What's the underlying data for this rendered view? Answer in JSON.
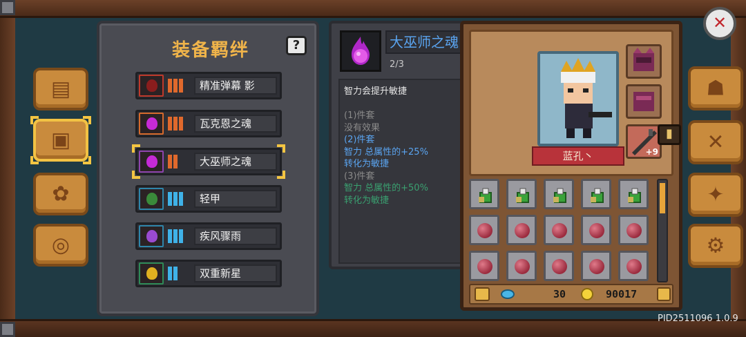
{
  "panel": {
    "title": "装备羁绊",
    "help_label": "?"
  },
  "sets": [
    {
      "name": "精准弹幕 影",
      "rarity": "orange",
      "tiers": 3,
      "icon": "fire-orb-icon",
      "icon_color": "#c0392b"
    },
    {
      "name": "瓦克恩之魂",
      "rarity": "orange",
      "tiers": 3,
      "icon": "purple-soul-flame-icon",
      "icon_color": "#d66a2c"
    },
    {
      "name": "大巫师之魂",
      "rarity": "orange",
      "tiers": 2,
      "icon": "purple-soul-flame-icon",
      "icon_color": "#8e44ad",
      "selected": true
    },
    {
      "name": "轻甲",
      "rarity": "blue",
      "tiers": 3,
      "icon": "leather-armor-icon",
      "icon_color": "#2e86ab"
    },
    {
      "name": "疾风骤雨",
      "rarity": "blue",
      "tiers": 3,
      "icon": "whirlwind-icon",
      "icon_color": "#2e86ab"
    },
    {
      "name": "双重新星",
      "rarity": "blue",
      "tiers": 2,
      "icon": "target-ring-icon",
      "icon_color": "#2e8b57"
    }
  ],
  "tooltip": {
    "name": "大巫师之魂",
    "count": "2/3",
    "description": "智力会提升敏捷",
    "lines": [
      {
        "text": "",
        "color": "#cfcfcf"
      },
      {
        "text": "(1)件套",
        "color": "#8a8a8a"
      },
      {
        "text": "没有效果",
        "color": "#8a8a8a"
      },
      {
        "text": "(2)件套",
        "color": "#5aa4f0"
      },
      {
        "text": "智力 总属性的+25%",
        "color": "#5aa4f0"
      },
      {
        "text": "转化为敏捷",
        "color": "#5aa4f0"
      },
      {
        "text": "(3)件套",
        "color": "#8a8a8a"
      },
      {
        "text": "智力 总属性的+50%",
        "color": "#3aa070"
      },
      {
        "text": "转化为敏捷",
        "color": "#3aa070"
      }
    ]
  },
  "character": {
    "name": "蓝孔丶",
    "weapon_level": "+9"
  },
  "currency": {
    "gems": "30",
    "gold": "90017"
  },
  "version": "PID2511096 1.0.9",
  "colors": {
    "orange_bar": "#e0692c",
    "blue_bar": "#3fb2e8",
    "title": "#f0b44a"
  }
}
